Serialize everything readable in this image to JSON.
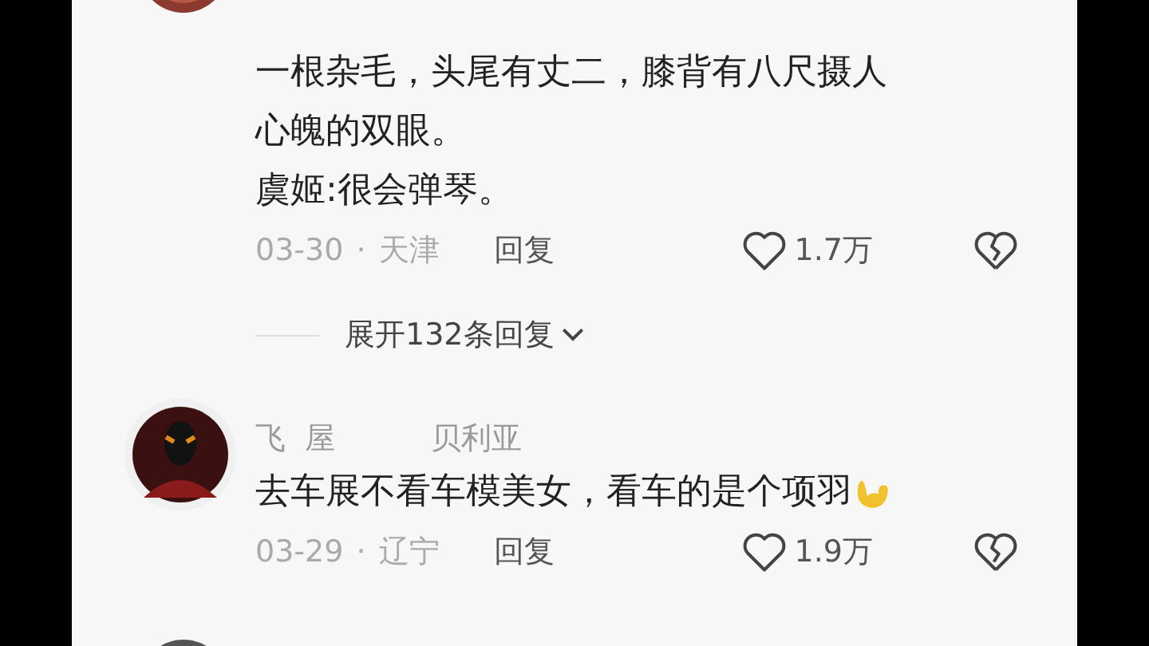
{
  "comments": [
    {
      "paragraphs": [
        [
          "一根杂毛，头尾有丈二，膝背有八尺摄人",
          "心魄的双眼。"
        ],
        [
          "虞姬:很会弹琴。"
        ]
      ],
      "date": "03-30",
      "separator": "·",
      "location": "天津",
      "reply": "回复",
      "likes": "1.7万",
      "expand": "展开132条回复"
    },
    {
      "author": "飞  屋",
      "badge": "贝利亚",
      "paragraphs": [
        [
          "去车展不看车模美女，看车的是个项羽"
        ]
      ],
      "emoji": true,
      "date": "03-29",
      "separator": "·",
      "location": "辽宁",
      "reply": "回复",
      "likes": "1.9万"
    }
  ]
}
